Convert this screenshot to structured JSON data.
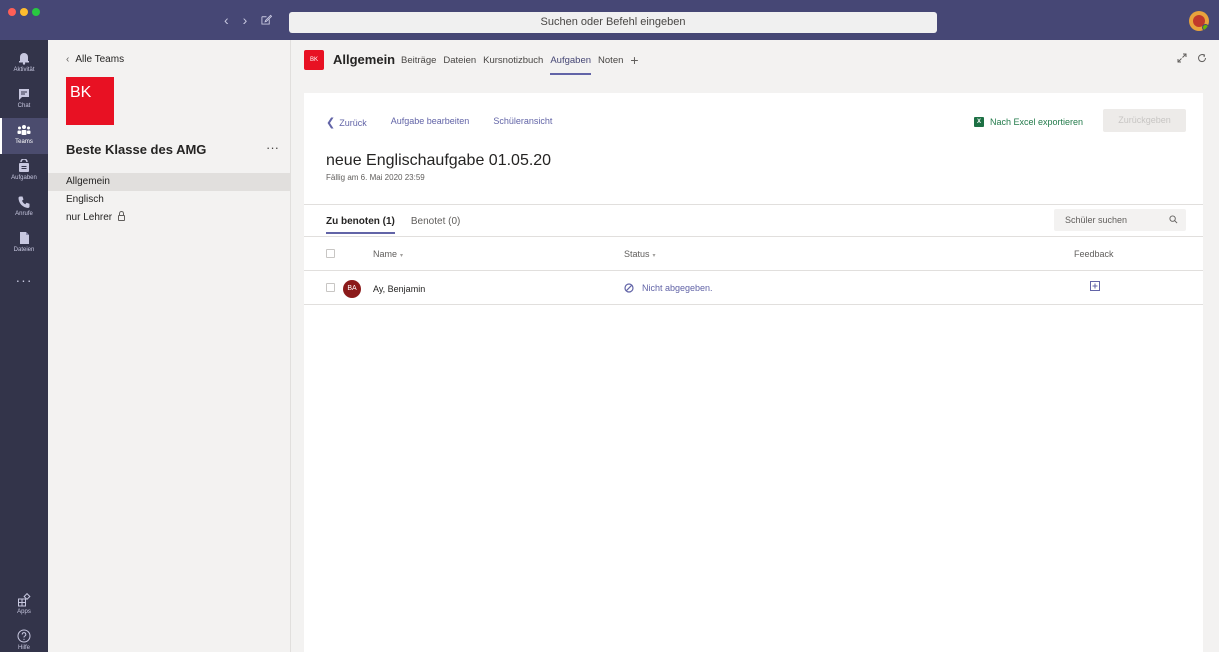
{
  "app": {
    "search_placeholder": "Suchen oder Befehl eingeben",
    "nav_back": "‹",
    "nav_forward": "›",
    "accent": "#6264a7",
    "titlebar_color": "#464775"
  },
  "rail": {
    "items": [
      {
        "label": "Aktivität",
        "icon": "bell-icon"
      },
      {
        "label": "Chat",
        "icon": "chat-icon"
      },
      {
        "label": "Teams",
        "icon": "teams-icon"
      },
      {
        "label": "Aufgaben",
        "icon": "assignments-icon"
      },
      {
        "label": "Anrufe",
        "icon": "phone-icon"
      },
      {
        "label": "Dateien",
        "icon": "files-icon"
      }
    ],
    "more": "···",
    "bottom": [
      {
        "label": "Apps",
        "icon": "apps-icon"
      },
      {
        "label": "Hilfe",
        "icon": "help-icon"
      }
    ]
  },
  "team_panel": {
    "back_label": "Alle Teams",
    "tile_initials": "BK",
    "team_name": "Beste Klasse des AMG",
    "more": "···",
    "channels": [
      "Allgemein",
      "Englisch",
      "nur Lehrer"
    ]
  },
  "channel": {
    "tile_initials": "BK",
    "title": "Allgemein",
    "tabs": [
      "Beiträge",
      "Dateien",
      "Kursnotizbuch",
      "Aufgaben",
      "Noten"
    ],
    "active_tab": "Aufgaben"
  },
  "assignment": {
    "back_label": "Zurück",
    "edit_label": "Aufgabe bearbeiten",
    "student_view_label": "Schüleransicht",
    "export_label": "Nach Excel exportieren",
    "return_label": "Zurückgeben",
    "title": "neue Englischaufgabe 01.05.20",
    "due": "Fällig am 6. Mai 2020 23:59",
    "filter_tabs": [
      "Zu benoten (1)",
      "Benotet (0)"
    ],
    "search_placeholder": "Schüler suchen",
    "columns": {
      "name": "Name",
      "status": "Status",
      "feedback": "Feedback"
    },
    "sort_glyph": "▾",
    "rows": [
      {
        "initials": "BA",
        "name": "Ay, Benjamin",
        "status": "Nicht abgegeben."
      }
    ]
  }
}
